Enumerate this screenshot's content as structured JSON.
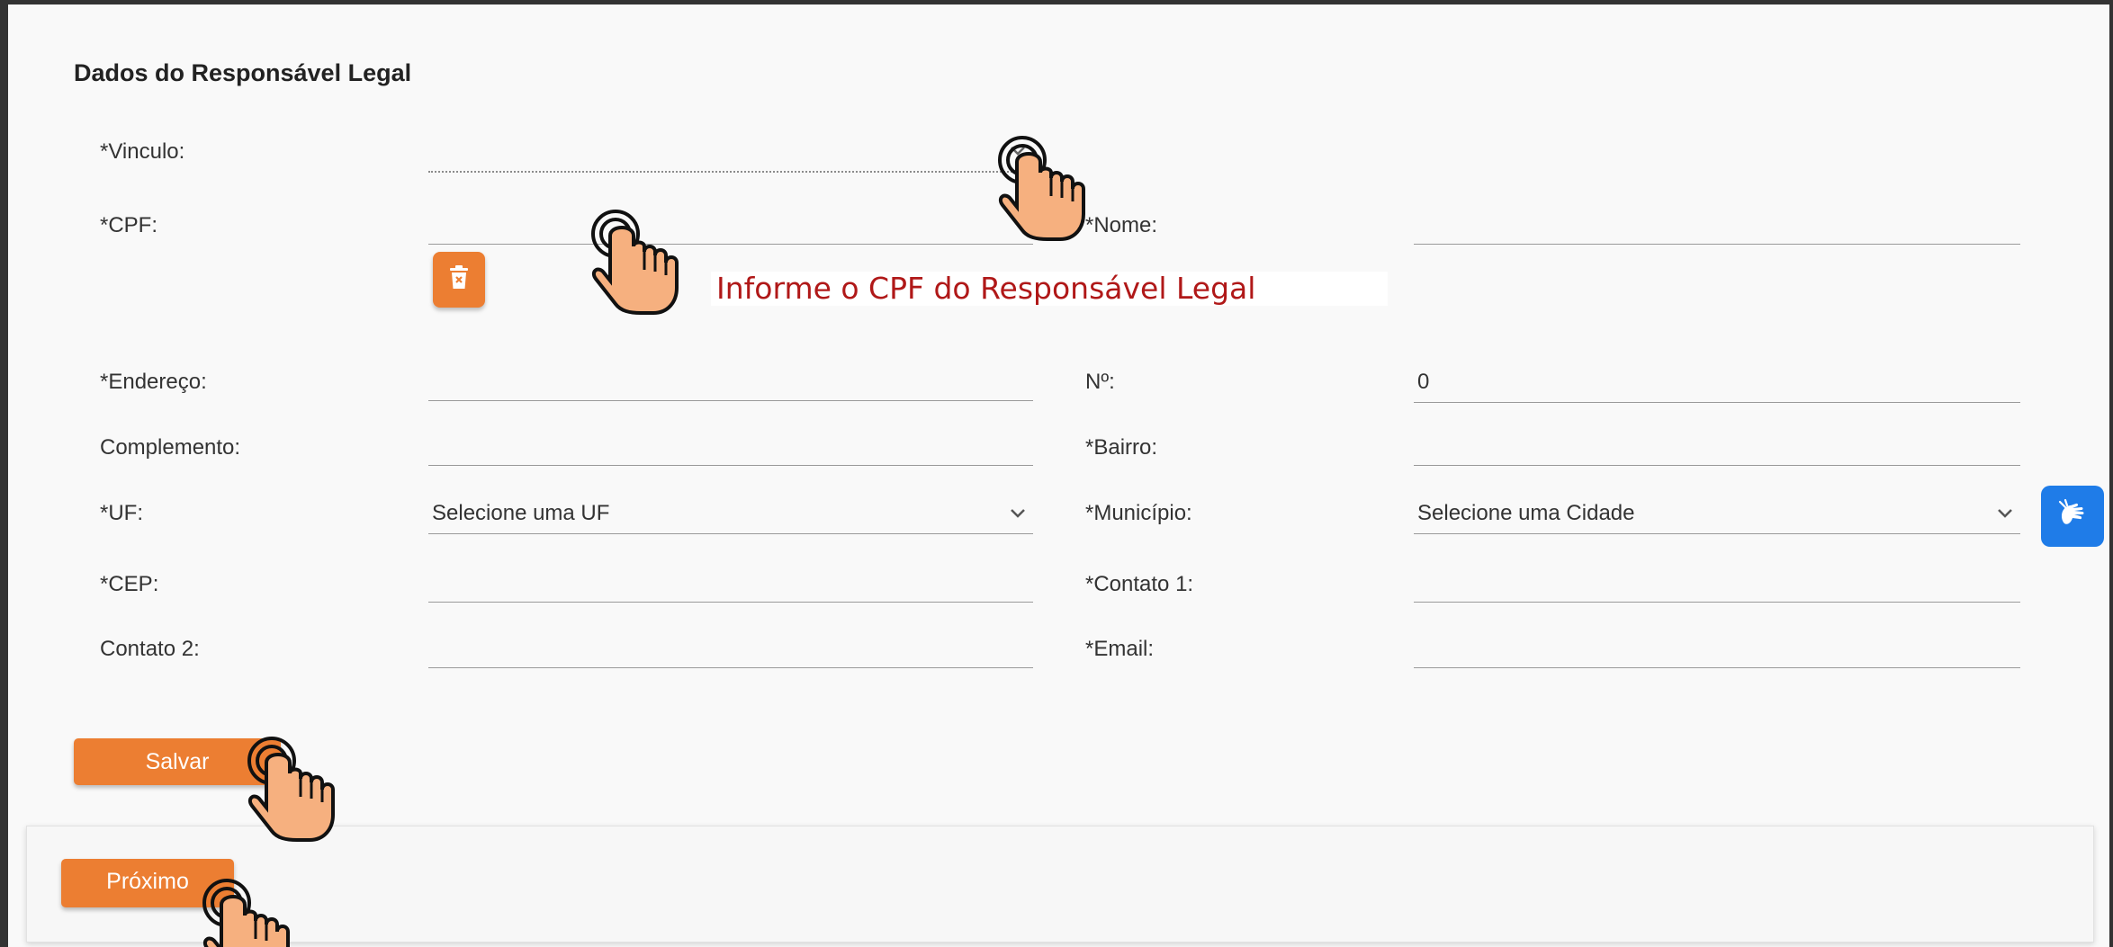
{
  "section": {
    "title": "Dados do Responsável Legal"
  },
  "fields": {
    "vinculo": {
      "label": "*Vinculo:",
      "value": ""
    },
    "cpf": {
      "label": "*CPF:",
      "value": ""
    },
    "nome": {
      "label": "*Nome:",
      "value": ""
    },
    "endereco": {
      "label": "*Endereço:",
      "value": ""
    },
    "numero": {
      "label": "Nº:",
      "value": "0"
    },
    "complemento": {
      "label": "Complemento:",
      "value": ""
    },
    "bairro": {
      "label": "*Bairro:",
      "value": ""
    },
    "uf": {
      "label": "*UF:",
      "value": "Selecione uma UF"
    },
    "municipio": {
      "label": "*Município:",
      "value": "Selecione uma Cidade"
    },
    "cep": {
      "label": "*CEP:",
      "value": ""
    },
    "contato1": {
      "label": "*Contato 1:",
      "value": ""
    },
    "contato2": {
      "label": "Contato 2:",
      "value": ""
    },
    "email": {
      "label": "*Email:",
      "value": ""
    }
  },
  "hint": {
    "text": "Informe o CPF do Responsável Legal"
  },
  "buttons": {
    "save": "Salvar",
    "next": "Próximo"
  },
  "icons": {
    "delete": "trash-icon",
    "accessibility": "sign-language-icon",
    "pointer": "hand-pointer-icon",
    "dropdown": "chevron-down-icon"
  },
  "colors": {
    "accent": "#ec7e32",
    "hint_text": "#b01818",
    "accessibility": "#1f7ce8"
  }
}
